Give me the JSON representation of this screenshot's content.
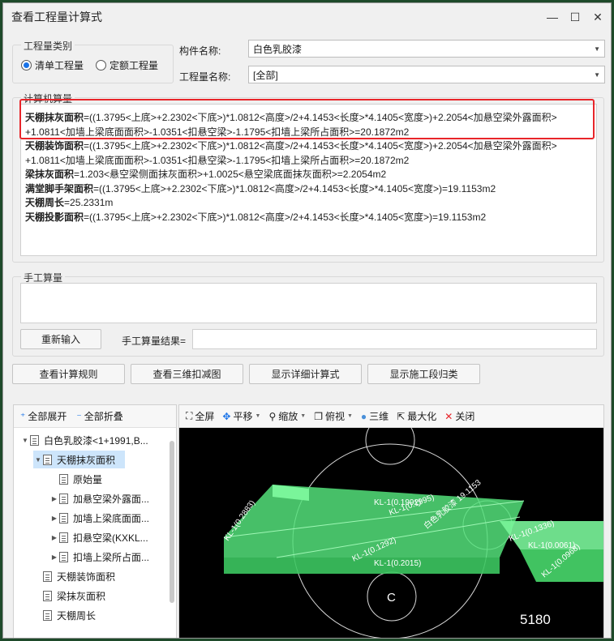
{
  "window": {
    "title": "查看工程量计算式"
  },
  "category_group": {
    "label": "工程量类别",
    "options": [
      {
        "label": "清单工程量",
        "selected": true
      },
      {
        "label": "定额工程量",
        "selected": false
      }
    ]
  },
  "component_name": {
    "label": "构件名称:",
    "value": "白色乳胶漆"
  },
  "quantity_name": {
    "label": "工程量名称:",
    "value": "[全部]"
  },
  "machine_calc": {
    "label": "计算机算量",
    "lines": [
      {
        "name": "天棚抹灰面积",
        "expr": "=((1.3795<上底>+2.2302<下底>)*1.0812<高度>/2+4.1453<长度>*4.1405<宽度>)+2.2054<加悬空梁外露面积>"
      },
      {
        "name": "",
        "expr": "+1.0811<加墙上梁底面面积>-1.0351<扣悬空梁>-1.1795<扣墙上梁所占面积>=20.1872m2"
      },
      {
        "name": "天棚装饰面积",
        "expr": "=((1.3795<上底>+2.2302<下底>)*1.0812<高度>/2+4.1453<长度>*4.1405<宽度>)+2.2054<加悬空梁外露面积>"
      },
      {
        "name": "",
        "expr": "+1.0811<加墙上梁底面面积>-1.0351<扣悬空梁>-1.1795<扣墙上梁所占面积>=20.1872m2"
      },
      {
        "name": "梁抹灰面积",
        "expr": "=1.203<悬空梁侧面抹灰面积>+1.0025<悬空梁底面抹灰面积>=2.2054m2"
      },
      {
        "name": "满堂脚手架面积",
        "expr": "=((1.3795<上底>+2.2302<下底>)*1.0812<高度>/2+4.1453<长度>*4.1405<宽度>)=19.1153m2"
      },
      {
        "name": "天棚周长",
        "expr": "=25.2331m"
      },
      {
        "name": "天棚投影面积",
        "expr": "=((1.3795<上底>+2.2302<下底>)*1.0812<高度>/2+4.1453<长度>*4.1405<宽度>)=19.1153m2"
      }
    ]
  },
  "manual_calc": {
    "label": "手工算量",
    "reenter_button": "重新输入",
    "result_label": "手工算量结果="
  },
  "buttons": {
    "view_rules": "查看计算规则",
    "view_3d": "查看三维扣减图",
    "show_detail": "显示详细计算式",
    "show_stage": "显示施工段归类"
  },
  "tree": {
    "expand_all": "全部展开",
    "collapse_all": "全部折叠",
    "items": [
      {
        "label": "白色乳胶漆<1+1991,B...",
        "level": 0,
        "toggle": "▼"
      },
      {
        "label": "天棚抹灰面积",
        "level": 1,
        "toggle": "▼",
        "selected": true
      },
      {
        "label": "原始量",
        "level": 2,
        "toggle": ""
      },
      {
        "label": "加悬空梁外露面...",
        "level": 2,
        "toggle": "▶"
      },
      {
        "label": "加墙上梁底面面...",
        "level": 2,
        "toggle": "▶"
      },
      {
        "label": "扣悬空梁(KXKL...",
        "level": 2,
        "toggle": "▶"
      },
      {
        "label": "扣墙上梁所占面...",
        "level": 2,
        "toggle": "▶"
      },
      {
        "label": "天棚装饰面积",
        "level": 1,
        "toggle": ""
      },
      {
        "label": "梁抹灰面积",
        "level": 1,
        "toggle": ""
      },
      {
        "label": "天棚周长",
        "level": 1,
        "toggle": ""
      }
    ]
  },
  "view_toolbar": {
    "fullscreen": "全屏",
    "pan": "平移",
    "zoom": "缩放",
    "top_view": "俯视",
    "three_d": "三维",
    "maximize": "最大化",
    "close": "关闭"
  },
  "viewport": {
    "labels": {
      "kl_left": "KL-1(0.2883)",
      "kl_top": "KL-1(0.1992)",
      "kl_top_b": "KL-1(0.1995)",
      "white_latex": "白色乳胶漆 19.1153",
      "kl_right": "KL-1(0.1336)",
      "kl_right_b": "KL-1(0.0061)",
      "kl_right_c": "KL-1(0.0968)",
      "kl_bottom": "KL-1(0.1292)",
      "kl_bottom_b": "KL-1(0.2015)",
      "axis_c": "C",
      "dimension": "5180"
    },
    "colors": {
      "slab": "#54e07a",
      "beam": "#7af59a",
      "outline": "#d9d9d9"
    }
  },
  "colors": {
    "highlight": "#e8252a",
    "accent": "#1a73e8"
  }
}
